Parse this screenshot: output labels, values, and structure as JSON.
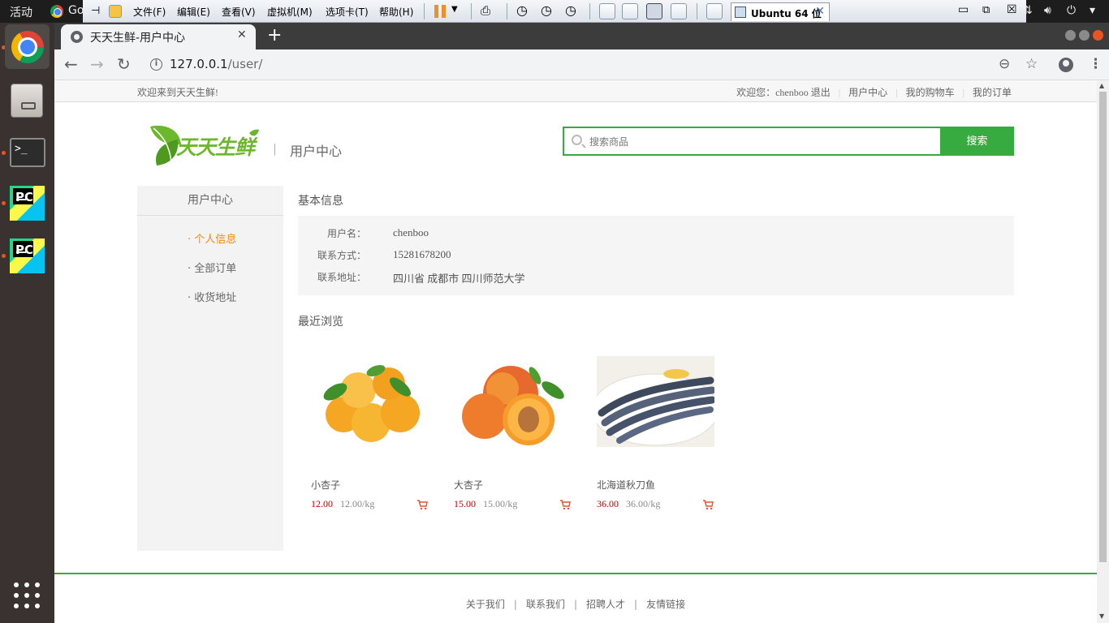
{
  "gnome": {
    "activities": "活动",
    "app_name": "Go"
  },
  "vmware": {
    "menus": [
      "文件(F)",
      "编辑(E)",
      "查看(V)",
      "虚拟机(M)",
      "选项卡(T)",
      "帮助(H)"
    ],
    "tab_label": "Ubuntu 64 位"
  },
  "browser": {
    "tab_title": "天天生鲜-用户中心",
    "url_host": "127.0.0.1",
    "url_path": "/user/"
  },
  "site": {
    "welcome": "欢迎来到天天生鲜!",
    "greeting": "欢迎您：chenboo",
    "logout": "退出",
    "top_links": [
      "用户中心",
      "我的购物车",
      "我的订单"
    ],
    "logo_text": "天天生鲜",
    "page_subtitle": "用户中心",
    "search_placeholder": "搜索商品",
    "search_button": "搜索"
  },
  "sidebar": {
    "title": "用户中心",
    "items": [
      {
        "label": "· 个人信息",
        "active": true
      },
      {
        "label": "· 全部订单",
        "active": false
      },
      {
        "label": "· 收货地址",
        "active": false
      }
    ]
  },
  "basic_info": {
    "title": "基本信息",
    "rows": [
      {
        "key": "用户名：",
        "value": "chenboo"
      },
      {
        "key": "联系方式：",
        "value": "15281678200"
      },
      {
        "key": "联系地址：",
        "value": "四川省 成都市 四川师范大学"
      }
    ]
  },
  "recent": {
    "title": "最近浏览",
    "products": [
      {
        "name": "小杏子",
        "price": "12.00",
        "unit": "12.00/kg"
      },
      {
        "name": "大杏子",
        "price": "15.00",
        "unit": "15.00/kg"
      },
      {
        "name": "北海道秋刀鱼",
        "price": "36.00",
        "unit": "36.00/kg"
      }
    ]
  },
  "footer": {
    "links": [
      "关于我们",
      "联系我们",
      "招聘人才",
      "友情链接"
    ]
  },
  "colors": {
    "brand_green": "#37ab40",
    "price_red": "#c40000",
    "active_orange": "#ff8800"
  }
}
